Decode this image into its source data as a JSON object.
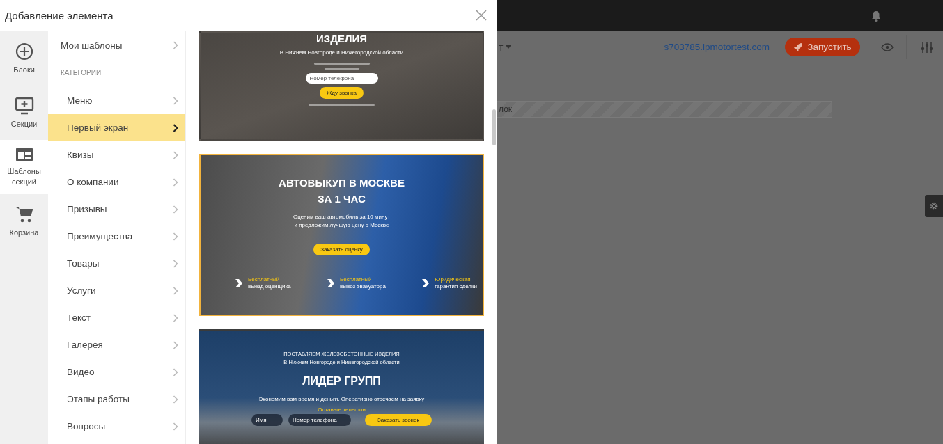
{
  "dialog": {
    "title": "Добавление элемента"
  },
  "rail": [
    {
      "label": "Блоки",
      "selected": false
    },
    {
      "label": "Секции",
      "selected": false
    },
    {
      "label": "Шаблоны секций",
      "selected": true
    },
    {
      "label": "Корзина",
      "selected": false
    }
  ],
  "my_templates": "Мои шаблоны",
  "categories_heading": "КАТЕГОРИИ",
  "categories": [
    {
      "label": "Меню",
      "selected": false
    },
    {
      "label": "Первый экран",
      "selected": true
    },
    {
      "label": "Квизы",
      "selected": false
    },
    {
      "label": "О компании",
      "selected": false
    },
    {
      "label": "Призывы",
      "selected": false
    },
    {
      "label": "Преимущества",
      "selected": false
    },
    {
      "label": "Товары",
      "selected": false
    },
    {
      "label": "Услуги",
      "selected": false
    },
    {
      "label": "Текст",
      "selected": false
    },
    {
      "label": "Галерея",
      "selected": false
    },
    {
      "label": "Видео",
      "selected": false
    },
    {
      "label": "Этапы работы",
      "selected": false
    },
    {
      "label": "Вопросы",
      "selected": false
    }
  ],
  "templates": [
    {
      "kind": "form",
      "selected": false,
      "heading": "ИЗДЕЛИЯ",
      "subtitle": "В Нижнем Новгороде и Нижегородской области",
      "field_placeholder": "Номер телефона",
      "button": "Жду звонка"
    },
    {
      "kind": "hero",
      "selected": true,
      "heading": [
        "АВТОВЫКУП В МОСКВЕ",
        "ЗА 1 ЧАС"
      ],
      "subtitle": [
        "Оценим ваш автомобиль за 10 минут",
        "и предложим лучшую цену в Москве"
      ],
      "button": "Заказать оценку",
      "features": [
        {
          "accent": "Бесплатный",
          "text": "выезд оценщика"
        },
        {
          "accent": "Бесплатный",
          "text": "вывоз эвакуатора"
        },
        {
          "accent": "Юридическая",
          "text": "гарантия сделки"
        }
      ]
    },
    {
      "kind": "banner",
      "selected": false,
      "eyebrow": [
        "ПОСТАВЛЯЕМ ЖЕЛЕЗОБЕТОННЫЕ ИЗДЕЛИЯ",
        "В Нижнем Новгороде и Нижегородской области"
      ],
      "heading": "ЛИДЕР ГРУПП",
      "subtitle": "Экономим вам время и деньги. Оперативно отвечаем на заявку",
      "prompt": "Оставьте телефон",
      "fields": [
        "Имя",
        "Номер телефона"
      ],
      "button": "Заказать звонок"
    }
  ],
  "editor": {
    "menu_fragment": "т",
    "site_url": "s703785.lpmotortest.com",
    "launch_button": "Запустить",
    "block_fragment": "лок"
  }
}
